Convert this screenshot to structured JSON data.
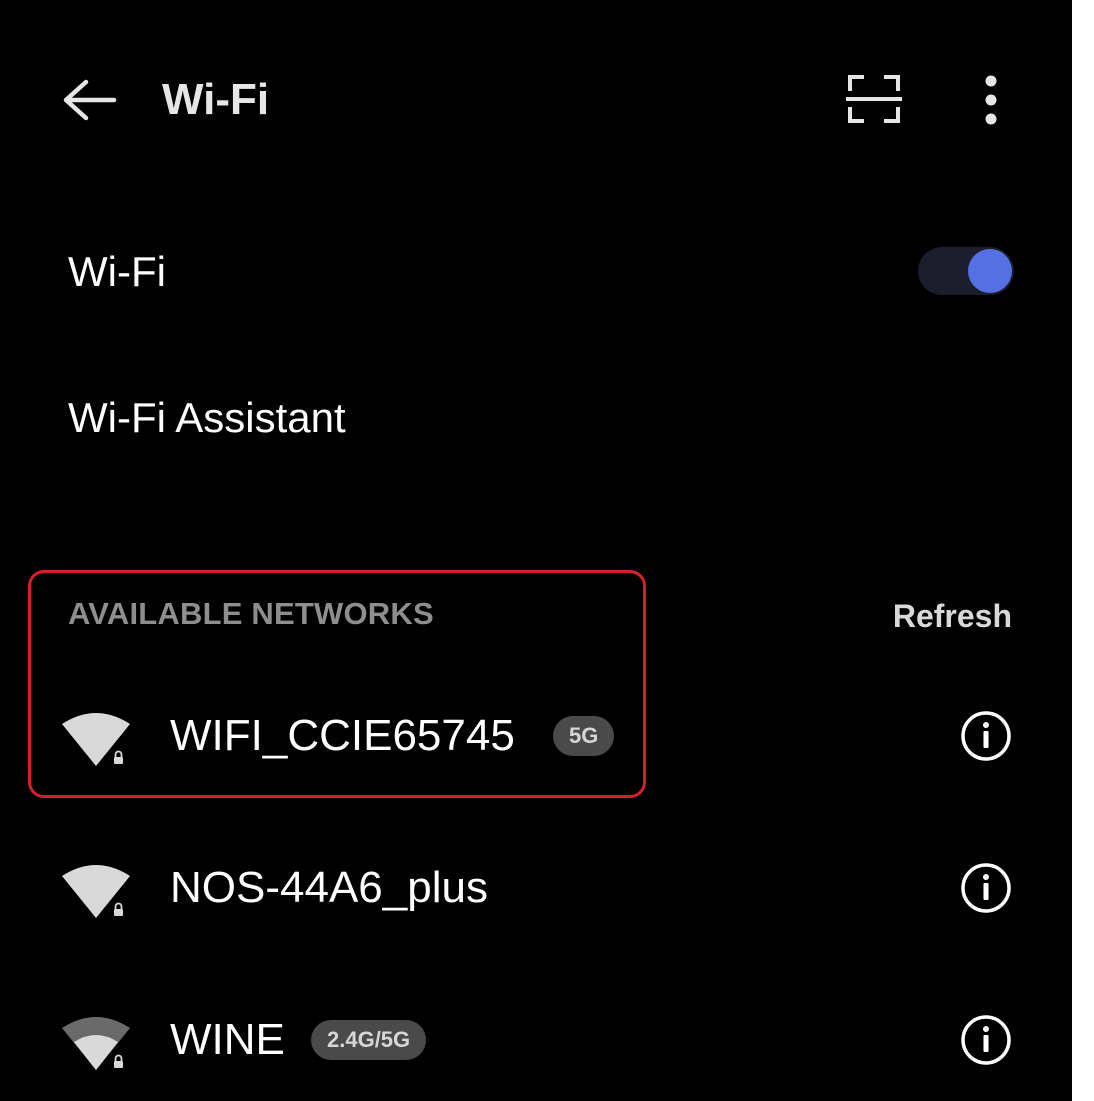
{
  "header": {
    "title": "Wi-Fi",
    "back_icon": "arrow-left-icon",
    "scan_icon": "scan-qr-icon",
    "more_icon": "more-vertical-icon"
  },
  "settings": {
    "wifi_label": "Wi-Fi",
    "wifi_enabled": true,
    "assistant_label": "Wi-Fi Assistant"
  },
  "networks_section": {
    "header": "AVAILABLE NETWORKS",
    "refresh_label": "Refresh",
    "networks": [
      {
        "name": "WIFI_CCIE65745",
        "band": "5G",
        "secured": true
      },
      {
        "name": "NOS-44A6_plus",
        "band": "",
        "secured": true
      },
      {
        "name": "WINE",
        "band": "2.4G/5G",
        "secured": true
      }
    ]
  },
  "colors": {
    "background": "#000000",
    "toggle_on": "#5470e3",
    "highlight": "#d4202c",
    "badge": "#4a4a4a"
  }
}
